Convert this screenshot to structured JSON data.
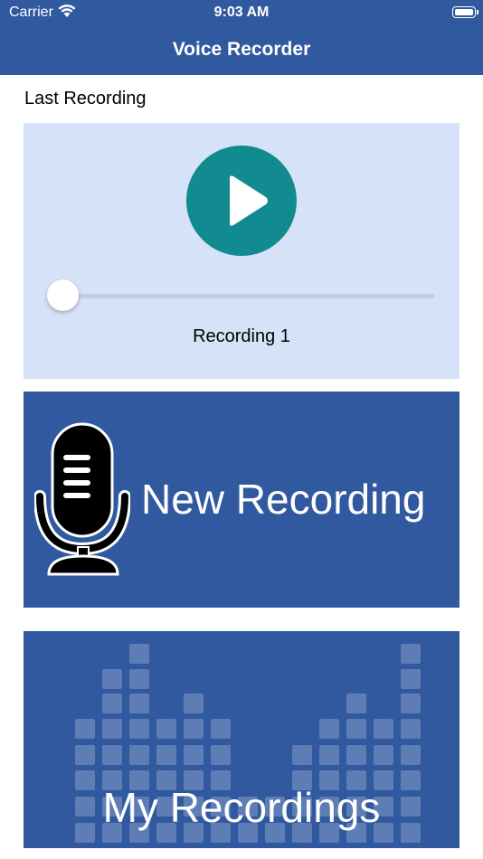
{
  "status_bar": {
    "carrier": "Carrier",
    "time": "9:03 AM",
    "wifi_icon": "wifi-icon",
    "battery_icon": "battery-icon"
  },
  "nav": {
    "title": "Voice Recorder"
  },
  "last_recording": {
    "section_label": "Last Recording",
    "recording_name": "Recording 1",
    "play_icon": "play-icon",
    "progress": 0
  },
  "new_recording": {
    "label": "New Recording",
    "icon": "microphone-icon"
  },
  "my_recordings": {
    "label": "My Recordings",
    "icon": "equalizer-icon"
  },
  "colors": {
    "bar": "#3159a0",
    "player_bg": "#d5e2f7",
    "play_button": "#118a90",
    "tile": "#3159a0"
  }
}
